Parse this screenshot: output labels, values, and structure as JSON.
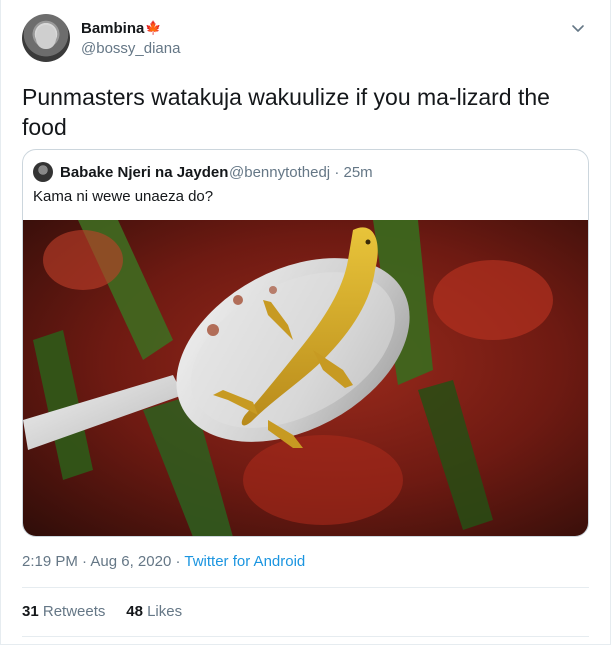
{
  "author": {
    "name": "Bambina",
    "flag": "🍁",
    "handle": "@bossy_diana"
  },
  "tweet": {
    "text": "Punmasters watakuja wakuulize if you ma-lizard the food"
  },
  "quoted": {
    "name": "Babake Njeri na Jayden",
    "handle": "@bennytothedj",
    "sep": "·",
    "time": "25m",
    "text": "Kama ni wewe unaeza do?"
  },
  "meta": {
    "time": "2:19 PM",
    "sep1": "·",
    "date": "Aug 6, 2020",
    "sep2": "·",
    "source": "Twitter for Android"
  },
  "stats": {
    "retweets_count": "31",
    "retweets_label": "Retweets",
    "likes_count": "48",
    "likes_label": "Likes"
  },
  "colors": {
    "link": "#1b95e0",
    "secondary": "#657786",
    "border": "#e6ecf0"
  },
  "icons": [
    "chevron-down-icon",
    "maple-leaf-icon"
  ]
}
